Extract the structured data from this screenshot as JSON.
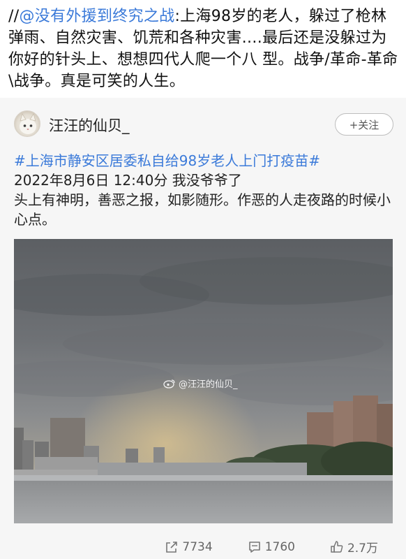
{
  "repost": {
    "prefix": "//",
    "mention": "@没有外援到终究之战",
    "text": ":上海98岁的老人，躲过了枪林弹雨、自然灾害、饥荒和各种灾害….最后还是没躲过为你好的针头上、想想四代人爬一个八 型。战争/革命-革命\\战争。真是可笑的人生。"
  },
  "original": {
    "username": "汪汪的仙贝_",
    "follow_label": "+关注",
    "hashtag": "#上海市静安区居委私自给98岁老人上门打疫苗#",
    "line1": "2022年8月6日 12:40分 我没爷爷了",
    "line2": "头上有神明，善恶之报，如影随形。作恶的人走夜路的时候小心点。",
    "watermark": "@汪汪的仙贝_"
  },
  "actions": {
    "repost_count": "7734",
    "comment_count": "1760",
    "like_count": "2.7万"
  },
  "icons": {
    "repost": "share-arrow-icon",
    "comment": "comment-bubble-icon",
    "like": "thumbs-up-icon",
    "weibo": "weibo-logo-icon"
  },
  "colors": {
    "link": "#3b7ad9",
    "card_bg": "#f6f6f6"
  }
}
